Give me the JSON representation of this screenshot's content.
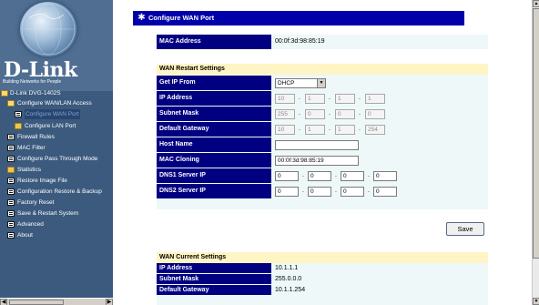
{
  "nav": {
    "brand": "D-Link",
    "tagline": "Building Networks for People",
    "items": [
      {
        "label": "D-Link DVG-1402S",
        "icon": "folder-open-icon"
      },
      {
        "label": "Configure WAN/LAN Access",
        "icon": "folder-open-icon"
      },
      {
        "label": "Configure WAN Port",
        "icon": "page-icon"
      },
      {
        "label": "Configure LAN Port",
        "icon": "folder-icon"
      },
      {
        "label": "Firewall Rules",
        "icon": "page-icon"
      },
      {
        "label": "MAC Filter",
        "icon": "page-icon"
      },
      {
        "label": "Configure Pass Through Mode",
        "icon": "page-icon"
      },
      {
        "label": "Statistics",
        "icon": "folder-icon"
      },
      {
        "label": "Restore Image File",
        "icon": "page-icon"
      },
      {
        "label": "Configuration Restore & Backup",
        "icon": "page-icon"
      },
      {
        "label": "Factory Reset",
        "icon": "page-icon"
      },
      {
        "label": "Save & Restart System",
        "icon": "page-icon"
      },
      {
        "label": "Advanced",
        "icon": "page-icon"
      },
      {
        "label": "About",
        "icon": "page-icon"
      }
    ]
  },
  "page": {
    "title": "Configure WAN Port",
    "title_icon": "gear-icon"
  },
  "mac_section": {
    "label": "MAC Address",
    "value": "00:0f:3d:98:85:19"
  },
  "restart": {
    "heading": "WAN Restart Settings",
    "get_ip_label": "Get IP From",
    "get_ip_value": "DHCP",
    "ip_label": "IP Address",
    "ip": [
      "10",
      "1",
      "1",
      "1"
    ],
    "subnet_label": "Subnet Mask",
    "subnet": [
      "255",
      "0",
      "0",
      "0"
    ],
    "gateway_label": "Default Gateway",
    "gateway": [
      "10",
      "1",
      "1",
      "254"
    ],
    "host_label": "Host Name",
    "host_value": "",
    "clone_label": "MAC Cloning",
    "clone_value": "00:0f:3d:98:85:19",
    "dns1_label": "DNS1 Server IP",
    "dns1": [
      "0",
      "0",
      "0",
      "0"
    ],
    "dns2_label": "DNS2 Server IP",
    "dns2": [
      "0",
      "0",
      "0",
      "0"
    ]
  },
  "save_label": "Save",
  "current": {
    "heading": "WAN Current Settings",
    "ip_label": "IP Address",
    "ip_value": "10.1.1.1",
    "subnet_label": "Subnet Mask",
    "subnet_value": "255.0.0.0",
    "gateway_label": "Default Gateway",
    "gateway_value": "10.1.1.254"
  },
  "colors": {
    "nav_bg": "#3b5a7e",
    "title_bar": "#0000aa",
    "label_cell": "#000080",
    "section_head": "#fff4c4",
    "panel_bg": "#eef8f8"
  }
}
